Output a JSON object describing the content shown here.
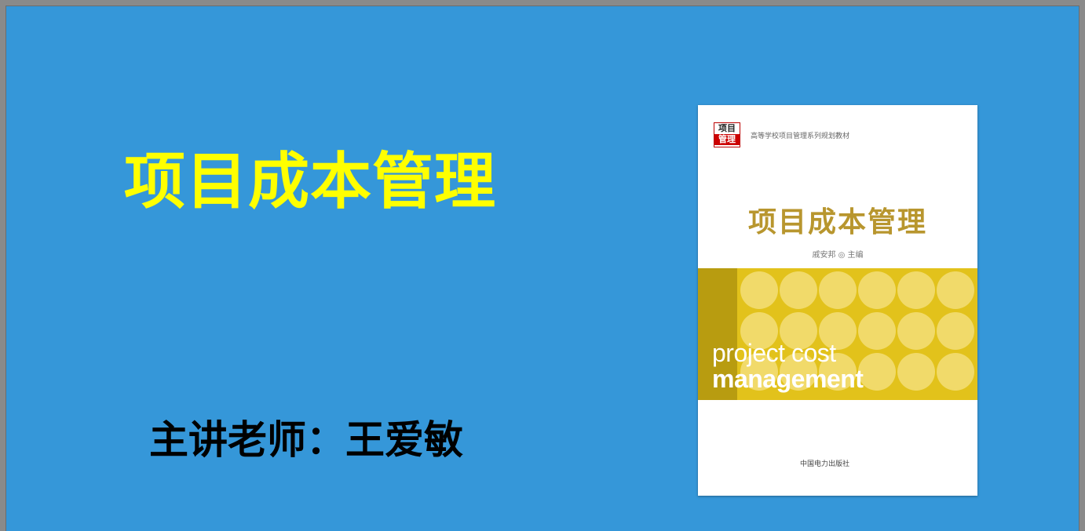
{
  "slide": {
    "title": "项目成本管理",
    "lecturer": "主讲老师：王爱敏"
  },
  "book": {
    "series_logo_top": "项目",
    "series_logo_bottom": "管理",
    "series": "高等学校项目管理系列规划教材",
    "title": "项目成本管理",
    "author": "戚安邦 ◎ 主编",
    "english_line1": "project cost",
    "english_line2": "management",
    "publisher": "中国电力出版社"
  },
  "colors": {
    "slide_background": "#3597d9",
    "title": "#ffff00",
    "book_title": "#b8962e",
    "band": "#e2c21b"
  }
}
